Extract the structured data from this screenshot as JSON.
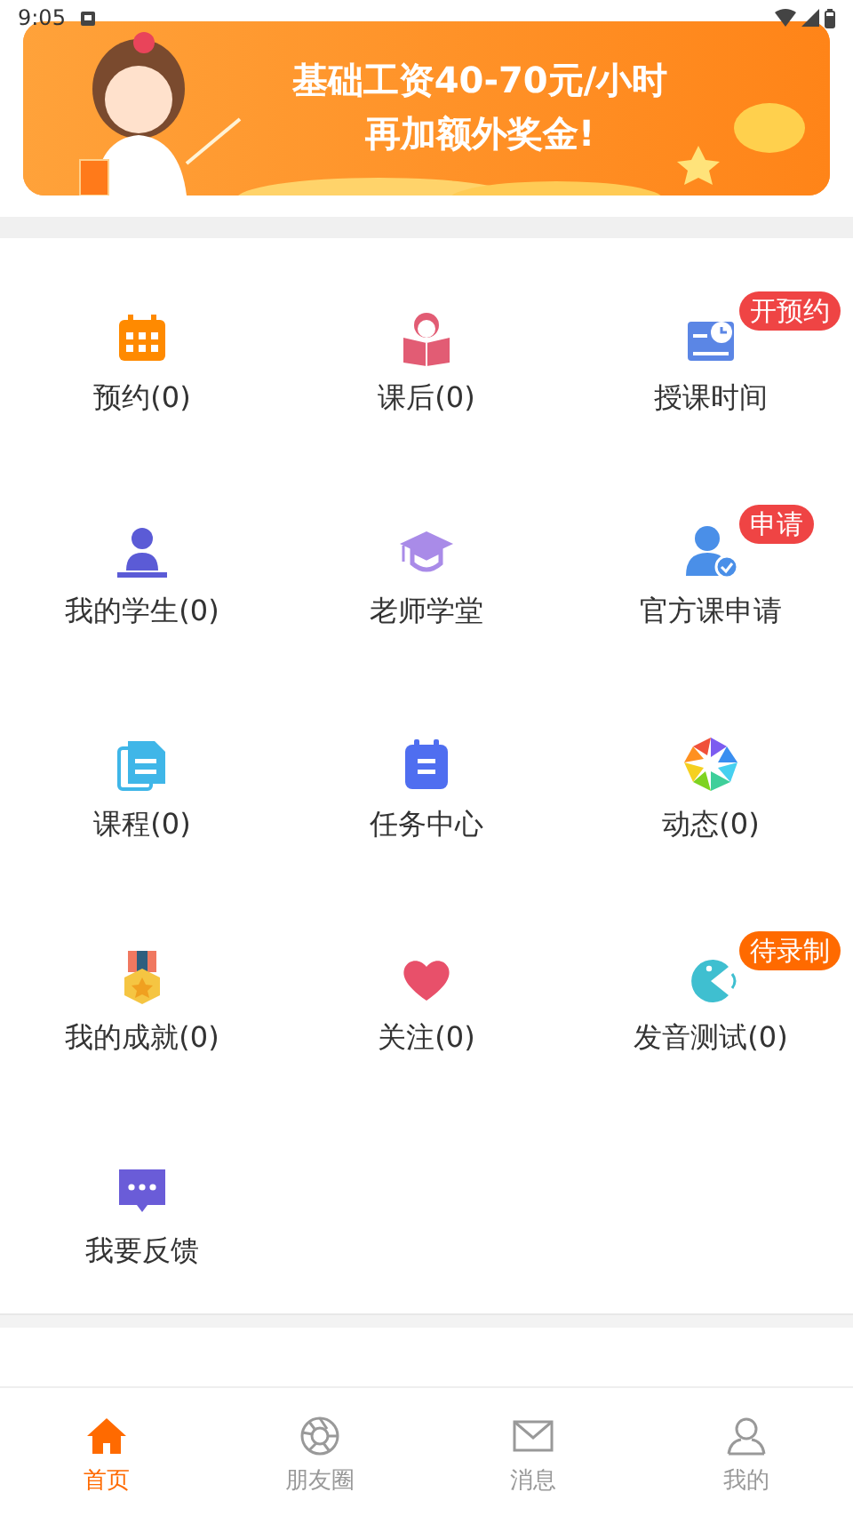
{
  "status_bar": {
    "time": "9:05"
  },
  "banner": {
    "line_1": "基础工资40-70元/小时",
    "line_2": "再加额外奖金!"
  },
  "grid": [
    {
      "label": "预约(0)"
    },
    {
      "label": "课后(0)"
    },
    {
      "label": "授课时间",
      "badge": {
        "text": "开预约",
        "color": "#ef4444"
      }
    },
    {
      "label": "我的学生(0)"
    },
    {
      "label": "老师学堂"
    },
    {
      "label": "官方课申请",
      "badge": {
        "text": "申请",
        "color": "#ef4444"
      }
    },
    {
      "label": "课程(0)"
    },
    {
      "label": "任务中心"
    },
    {
      "label": "动态(0)"
    },
    {
      "label": "我的成就(0)"
    },
    {
      "label": "关注(0)"
    },
    {
      "label": "发音测试(0)",
      "badge": {
        "text": "待录制",
        "color": "#ff6a00"
      }
    },
    {
      "label": "我要反馈"
    }
  ],
  "tab_bar": [
    {
      "label": "首页",
      "selected": true
    },
    {
      "label": "朋友圈",
      "selected": false
    },
    {
      "label": "消息",
      "selected": false
    },
    {
      "label": "我的",
      "selected": false
    }
  ]
}
